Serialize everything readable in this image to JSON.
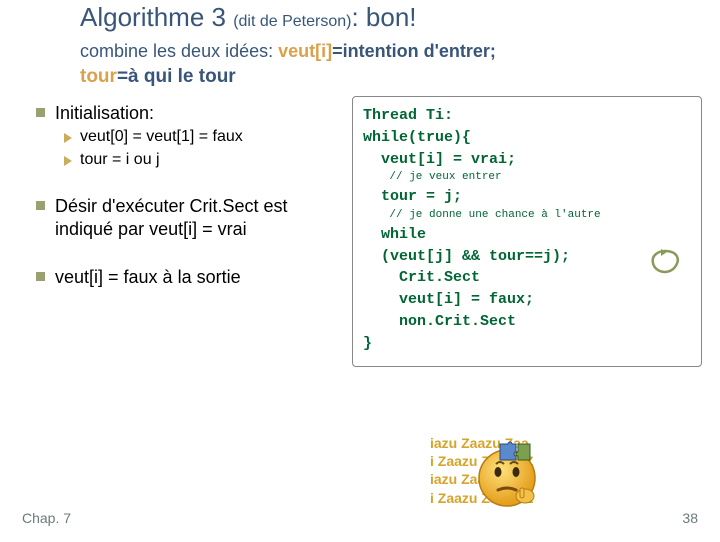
{
  "title": {
    "main": "Algorithme 3 ",
    "paren": "(dit de Peterson)",
    "tail": ": bon!"
  },
  "subtitle": {
    "lead": "combine les deux idées: ",
    "hl": "veut[i]",
    "eq": "=intention d'entrer;"
  },
  "tourline": {
    "hl": "tour",
    "rest": "=à qui le tour"
  },
  "left": {
    "b1": "Initialisation:",
    "b1a": "veut[0] = veut[1] = faux",
    "b1b": "tour = i ou j",
    "b2": "Désir d'exécuter Crit.Sect est indiqué par veut[i] = vrai",
    "b3": "veut[i] = faux à la sortie"
  },
  "code": {
    "l1": "Thread Ti:",
    "l2": "while(true){",
    "l3": "  veut[i] = vrai;",
    "c1": "    // je veux entrer",
    "l4": "  tour = j;",
    "c2": "    // je donne une chance à l'autre",
    "l5": "  while",
    "l6": "  (veut[j] && tour==j);",
    "l7": "    Crit.Sect",
    "l8": "    veut[i] = faux;",
    "l9": "    non.Crit.Sect",
    "l10": "}"
  },
  "footer": {
    "left": "Chap. 7",
    "right": "38"
  },
  "watermark": {
    "w": "iazu Zaazu Zaa",
    "w2": "i Zaazu Zaazu Z"
  }
}
